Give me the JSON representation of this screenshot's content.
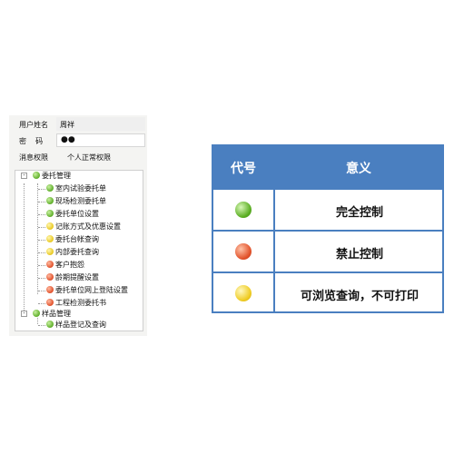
{
  "form": {
    "username_label": "用户姓名",
    "username_value": "周祥",
    "password_label": "密    码",
    "password_dots": "●●",
    "permission_label": "消息权限",
    "permission_value": "个人正常权限"
  },
  "tree": {
    "groups": [
      {
        "label": "委托管理",
        "status": "green",
        "children": [
          {
            "label": "室内试验委托单",
            "status": "green"
          },
          {
            "label": "现场检测委托单",
            "status": "green"
          },
          {
            "label": "委托单位设置",
            "status": "green"
          },
          {
            "label": "记账方式及优惠设置",
            "status": "yellow"
          },
          {
            "label": "委托台帐查询",
            "status": "yellow"
          },
          {
            "label": "内部委托查询",
            "status": "yellow"
          },
          {
            "label": "客户抱怨",
            "status": "red"
          },
          {
            "label": "龄期提醒设置",
            "status": "red"
          },
          {
            "label": "委托单位网上登陆设置",
            "status": "red"
          },
          {
            "label": "工程检测委托书",
            "status": "red"
          }
        ]
      },
      {
        "label": "样品管理",
        "status": "green",
        "children": [
          {
            "label": "样品登记及查询",
            "status": "green"
          }
        ]
      }
    ]
  },
  "legend": {
    "header_code": "代号",
    "header_meaning": "意义",
    "rows": [
      {
        "status": "green",
        "meaning": "完全控制"
      },
      {
        "status": "red",
        "meaning": "禁止控制"
      },
      {
        "status": "yellow",
        "meaning": "可浏览查询，不可打印"
      }
    ]
  },
  "colors": {
    "green": "#5fae2a",
    "red": "#e0502a",
    "yellow": "#e8c820",
    "table_accent": "#4a7fc0"
  }
}
